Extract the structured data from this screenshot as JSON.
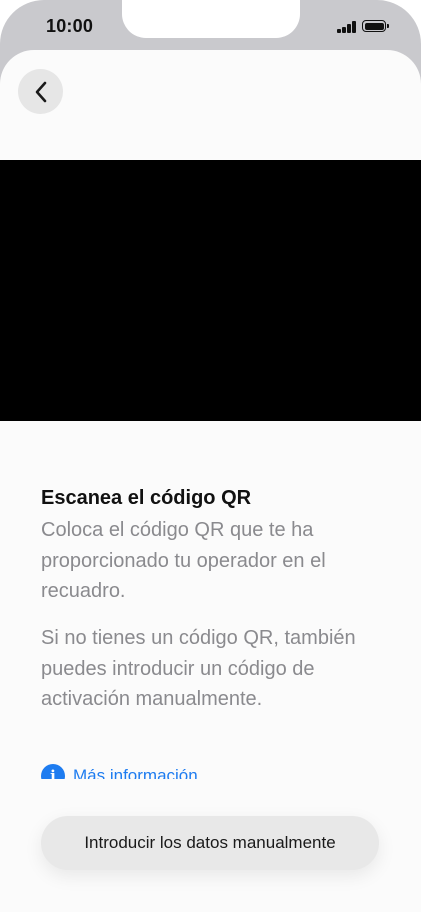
{
  "status_bar": {
    "time": "10:00",
    "signal_icon": "cellular-signal-icon",
    "battery_icon": "battery-icon"
  },
  "nav": {
    "back_icon": "chevron-left-icon"
  },
  "content": {
    "title": "Escanea el código QR",
    "instructions": "Coloca el código QR que te ha proporcionado tu operador en el recuadro.",
    "alternative": "Si no tienes un código QR, también puedes introducir un código de activación manualmente.",
    "more_info_label": "Más información",
    "more_info_icon": "info-icon"
  },
  "actions": {
    "manual_entry_label": "Introducir los datos manualmente"
  },
  "colors": {
    "link": "#1e7cf0",
    "camera_view": "#000000",
    "body_text": "#8a8a8e"
  }
}
